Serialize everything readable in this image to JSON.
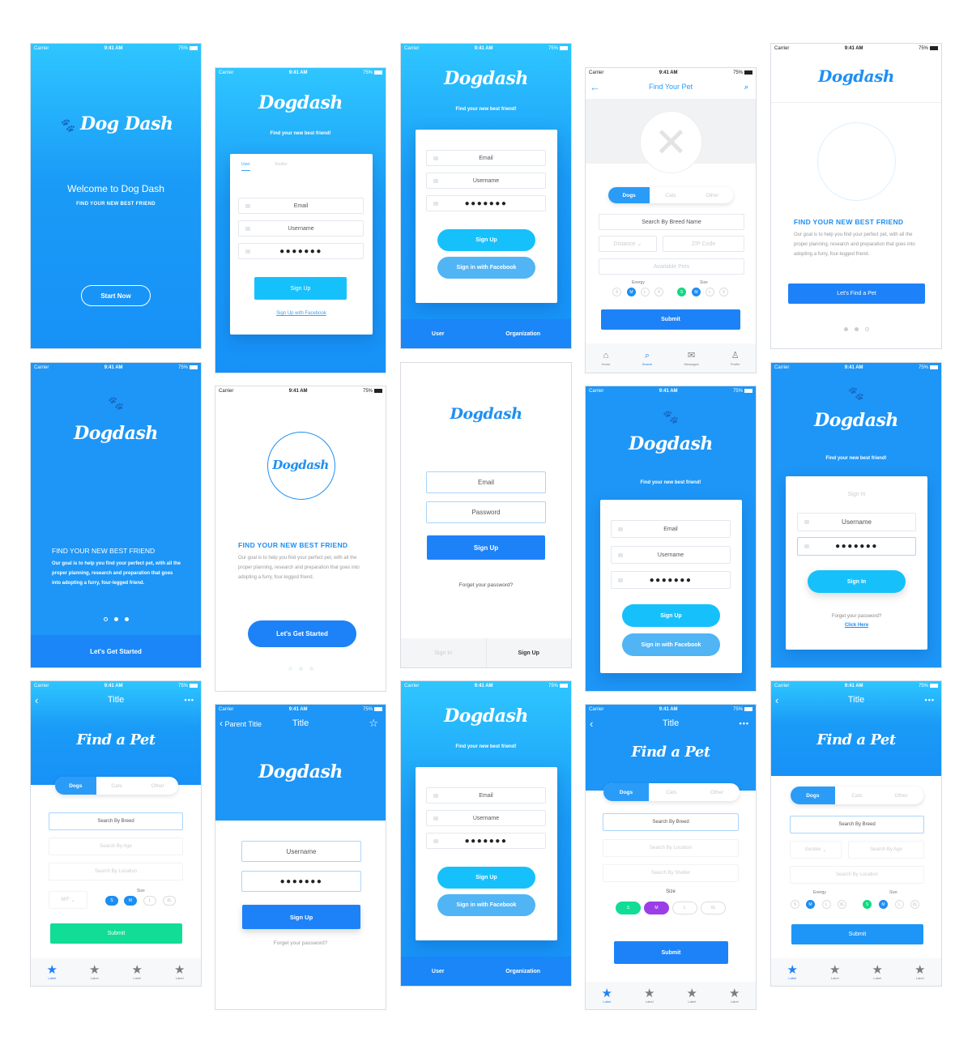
{
  "status_bar": {
    "signal": "●●●●",
    "carrier": "Carrier",
    "wifi": "≈",
    "time": "9:41 AM",
    "battery": "75%"
  },
  "brand": {
    "logo_full": "Dog Dash",
    "logo_script": "Dogdash",
    "paw": "🐾"
  },
  "colors": {
    "primary": "#1d82f7",
    "cyan": "#16c1fb",
    "facebook": "#50b4f5",
    "green": "#11d983",
    "purple": "#9b3ee8"
  },
  "screens": {
    "welcome": {
      "title": "Welcome to Dog Dash",
      "subtitle": "FIND YOUR NEW BEST FRIEND",
      "start_button": "Start Now"
    },
    "signup_tabs": {
      "tagline": "Find your new best friend!",
      "tabs": [
        "User",
        "Shelter"
      ],
      "email": "Email",
      "username": "Username",
      "password": "●●●●●●●",
      "signup_button": "Sign Up",
      "facebook_link": "Sign Up with Facebook"
    },
    "signup_fb": {
      "tagline": "Find your new best friend!",
      "email": "Email",
      "username": "Username",
      "password": "●●●●●●●",
      "signup_button": "Sign Up",
      "facebook_button": "Sign in with Facebook",
      "bottom_tabs": [
        "User",
        "Organization"
      ]
    },
    "find_your_pet": {
      "title": "Find Your Pet",
      "segments": [
        "Dogs",
        "Cats",
        "Other"
      ],
      "breed_placeholder": "Search By Breed Name",
      "distance_placeholder": "Distance",
      "zip_placeholder": "ZIP Code",
      "available_placeholder": "Available Pets",
      "energy_label": "Energy",
      "size_label": "Size",
      "energy_options": [
        "S",
        "M",
        "L",
        "X"
      ],
      "size_options": [
        "S",
        "M",
        "L",
        "X"
      ],
      "submit": "Submit",
      "tabs": [
        "Home",
        "Search",
        "Messages",
        "Profile"
      ]
    },
    "onboard_white": {
      "heading": "FIND YOUR NEW BEST FRIEND",
      "body": "Our goal is to help you find your perfect pet, with all the proper planning, research and preparation that goes into adopting a furry, four-legged friend.",
      "button": "Let's Find a Pet"
    },
    "onboard_blue": {
      "heading": "FIND YOUR NEW BEST FRIEND",
      "body": "Our goal is to help you find your perfect pet, with all the proper planning, research and preparation that goes into adopting a furry, four-legged friend.",
      "button": "Let's Get Started"
    },
    "onboard_circle": {
      "heading": "FIND YOUR NEW BEST FRIEND",
      "body": "Our goal is to help you find your perfect pet, with all the proper planning, research and preparation that goes into adopting a furry, four-legged friend.",
      "button": "Let's Get Started"
    },
    "login_simple": {
      "email": "Email",
      "password": "Password",
      "signup_button": "Sign Up",
      "forgot": "Forget your password?",
      "tabs": [
        "Sign In",
        "Sign Up"
      ]
    },
    "signup_paw": {
      "tagline": "Find your new best friend!",
      "email": "Email",
      "username": "Username",
      "password": "●●●●●●●",
      "signup_button": "Sign Up",
      "facebook_button": "Sign in with Facebook"
    },
    "signin_card": {
      "tagline": "Find your new best friend!",
      "card_title": "Sign In",
      "username": "Username",
      "password": "●●●●●●●",
      "signin_button": "Sign In",
      "forgot": "Forget your password?",
      "click_here": "Click Here"
    },
    "find_pet_a": {
      "nav_title": "Title",
      "hero": "Find a Pet",
      "segments": [
        "Dogs",
        "Cats",
        "Other"
      ],
      "breed": "Search By Breed",
      "age": "Search By Age",
      "location": "Search By Location",
      "gender": "M/F",
      "size_label": "Size",
      "size_options": [
        "S",
        "M",
        "L",
        "XL"
      ],
      "submit": "Submit",
      "tab_label": "Label"
    },
    "login_nav": {
      "back": "Parent Title",
      "nav_title": "Title",
      "username": "Username",
      "password": "●●●●●●●",
      "signup_button": "Sign Up",
      "forgot": "Forget your password?"
    },
    "find_pet_b": {
      "nav_title": "Title",
      "hero": "Find a Pet",
      "segments": [
        "Dogs",
        "Cats",
        "Other"
      ],
      "breed": "Search By Breed",
      "location": "Search By Location",
      "shelter": "Search By Shelter",
      "size_label": "Size",
      "size_options": [
        "S",
        "M",
        "L",
        "XL"
      ],
      "submit": "Submit",
      "tab_label": "Label"
    },
    "find_pet_c": {
      "nav_title": "Title",
      "hero": "Find a Pet",
      "segments": [
        "Dogs",
        "Cats",
        "Other"
      ],
      "breed": "Search By Breed",
      "gender": "Gender",
      "age": "Search By Age",
      "location": "Search By Location",
      "energy_label": "Energy",
      "size_label": "Size",
      "energy_options": [
        "S",
        "M",
        "L",
        "XL"
      ],
      "size_options": [
        "S",
        "M",
        "L",
        "XL"
      ],
      "submit": "Submit",
      "tab_label": "Label"
    }
  }
}
